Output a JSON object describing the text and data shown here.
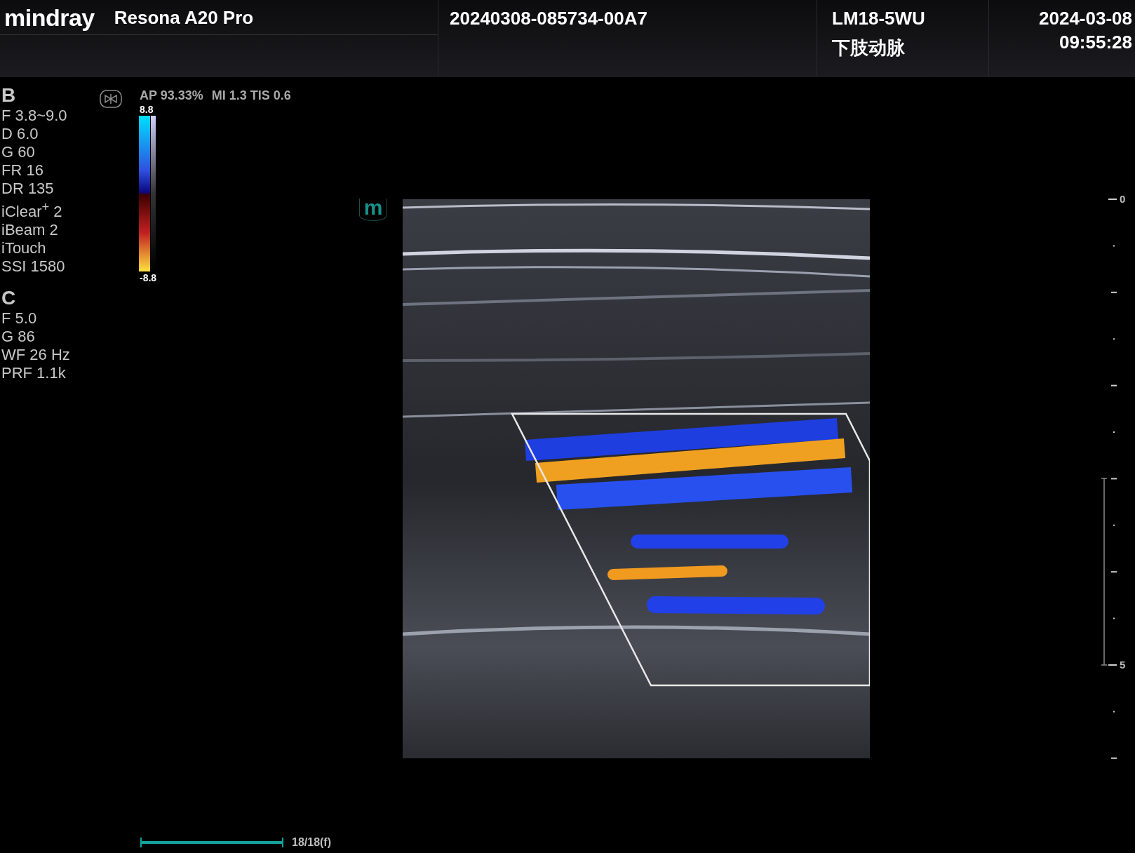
{
  "header": {
    "logo": "mindray",
    "model": "Resona A20 Pro",
    "exam_id": "20240308-085734-00A7",
    "probe": "LM18-5WU",
    "exam_type": "下肢动脉",
    "date": "2024-03-08",
    "time": "09:55:28"
  },
  "b_mode": {
    "title": "B",
    "params": [
      "F 3.8~9.0",
      "D 6.0",
      "G 60",
      "FR 16",
      "DR 135",
      "iClear$^{+}$ 2",
      "iBeam 2",
      "iTouch",
      "SSI 1580"
    ]
  },
  "c_mode": {
    "title": "C",
    "params": [
      "F 5.0",
      "G 86",
      "WF 26 Hz",
      "PRF 1.1k"
    ]
  },
  "acoustic_output": [
    "AP 93.33%",
    "MI 1.3 TIS 0.6"
  ],
  "color_scale": {
    "max": "8.8",
    "min": "-8.8"
  },
  "orientation_mark": "m",
  "depth_scale": {
    "top_label": "0",
    "label_5": "5"
  },
  "cine": {
    "level": 1,
    "frames": "18/18(f)"
  }
}
